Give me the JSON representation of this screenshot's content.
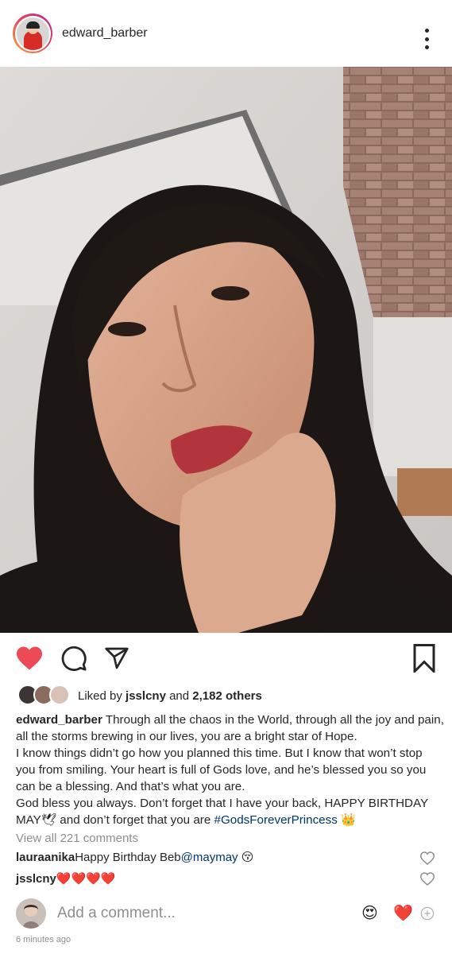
{
  "post": {
    "username": "edward_barber",
    "photo_alt": "",
    "liked_by_prefix": "Liked by ",
    "liked_by_user": "jsslcny",
    "liked_by_and": " and ",
    "liked_by_count": "2,182 others",
    "caption_user": "edward_barber",
    "caption_lines": [
      " Through all the chaos in the World, through all the joy and pain,",
      "all the storms brewing in our lives, you are a bright star of Hope.",
      "I know things didn’t go how you planned this time. But I know that won’t stop",
      "you from smiling. Your heart is full of Gods love, and he’s blessed you so you",
      "can be a blessing. And that’s what you are.",
      "God bless you always. Don’t forget that I have your back, HAPPY BIRTHDAY"
    ],
    "caption_last_start": "MAY",
    "caption_last_dove": "🕊",
    "caption_last_mid": " and don’t forget that you are ",
    "caption_hashtag": "#GodsForeverPrincess",
    "caption_crown": "👑",
    "view_all_comments": "View all 221 comments",
    "comments": [
      {
        "user": "lauraanika",
        "text": " Happy Birthday Beb ",
        "mention": "@maymay",
        "emoji": "😚"
      },
      {
        "user": "jsslcny",
        "text": " ",
        "emoji": "❤️❤️❤️❤️"
      }
    ],
    "add_comment_placeholder": "Add a comment...",
    "quick_emoji_1": "😍",
    "quick_emoji_2": "❤️",
    "timestamp": "6 minutes ago"
  },
  "colors": {
    "like_red": "#ed4956",
    "link_blue": "#003569",
    "muted_gray": "#8e8e8e"
  },
  "icons": {
    "more": "more-vertical-icon",
    "like": "heart-filled-icon",
    "comment": "comment-bubble-icon",
    "share": "paper-plane-icon",
    "save": "bookmark-icon"
  }
}
